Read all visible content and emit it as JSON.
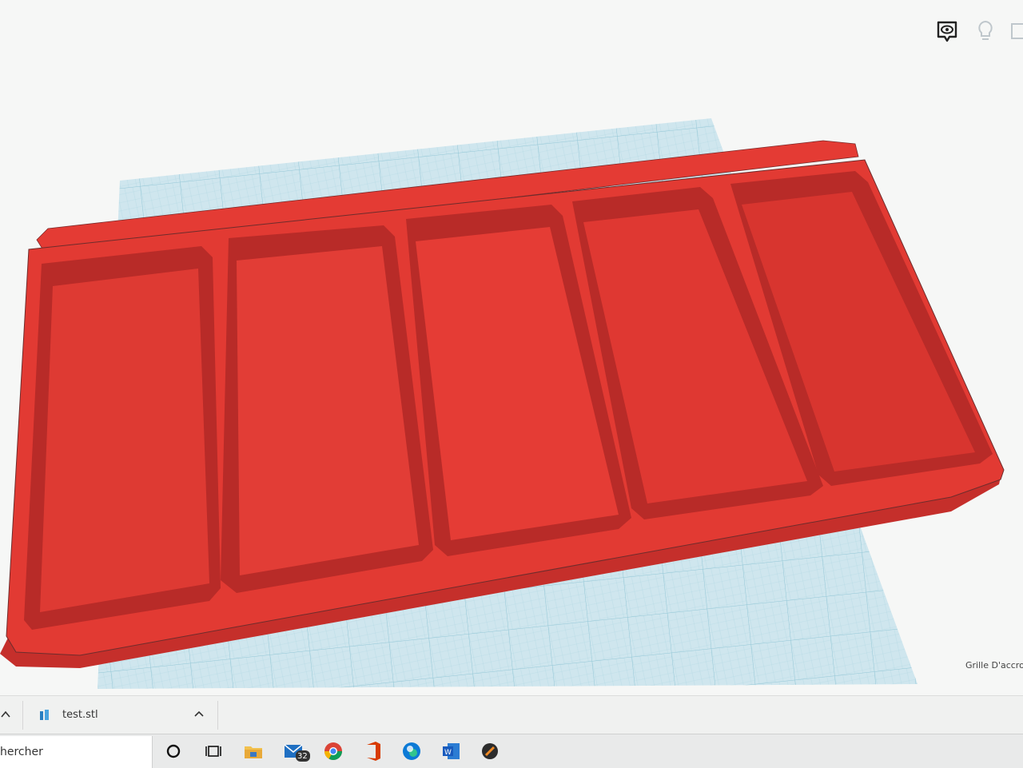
{
  "viewport": {
    "toolbar_icons": [
      "view-eye-icon",
      "lightbulb-icon",
      "notes-icon"
    ],
    "snap_grid_label": "Grille D'accroc",
    "model": {
      "compartments": 5,
      "color": "#e03a35",
      "workplane_color": "#cfe6ee"
    }
  },
  "download_bar": {
    "file_name": "test.stl",
    "icons": [
      "chevron-left-icon",
      "file-icon",
      "chevron-up-icon"
    ]
  },
  "taskbar": {
    "search_placeholder": "hercher",
    "mail_badge": "32",
    "apps": [
      "cortana-icon",
      "task-view-icon",
      "file-explorer-icon",
      "mail-icon",
      "chrome-icon",
      "office-icon",
      "edge-icon",
      "word-icon",
      "app-icon"
    ]
  },
  "colors": {
    "accent_red": "#e03a35",
    "grid_blue": "#bfe0ea",
    "taskbar_bg": "#e9eaea"
  }
}
